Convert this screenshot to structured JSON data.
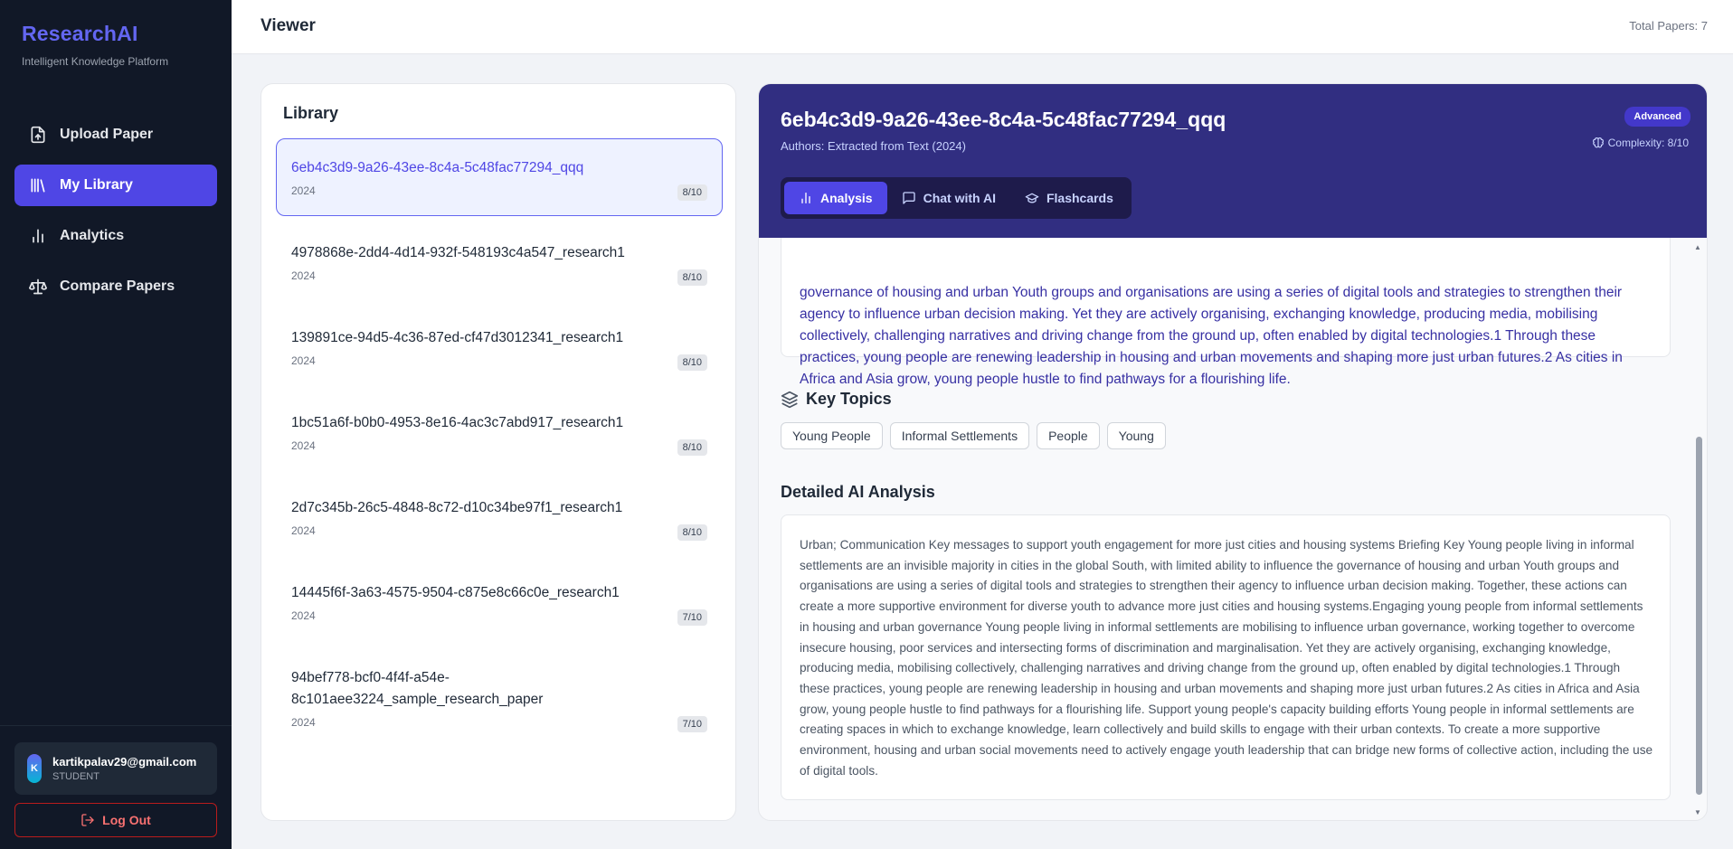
{
  "brand": {
    "title": "ResearchAI",
    "subtitle": "Intelligent Knowledge Platform"
  },
  "sidebar": {
    "items": [
      {
        "label": "Upload Paper",
        "icon": "upload-file-icon"
      },
      {
        "label": "My Library",
        "icon": "library-icon",
        "active": true
      },
      {
        "label": "Analytics",
        "icon": "bar-chart-icon"
      },
      {
        "label": "Compare Papers",
        "icon": "scale-icon"
      }
    ],
    "user": {
      "initial": "K",
      "email": "kartikpalav29@gmail.com",
      "role": "STUDENT"
    },
    "logout_label": "Log Out"
  },
  "header": {
    "title": "Viewer",
    "total_papers": "Total Papers: 7"
  },
  "library": {
    "title": "Library",
    "papers": [
      {
        "name": "6eb4c3d9-9a26-43ee-8c4a-5c48fac77294_qqq",
        "year": "2024",
        "score": "8/10"
      },
      {
        "name": "4978868e-2dd4-4d14-932f-548193c4a547_research1",
        "year": "2024",
        "score": "8/10"
      },
      {
        "name": "139891ce-94d5-4c36-87ed-cf47d3012341_research1",
        "year": "2024",
        "score": "8/10"
      },
      {
        "name": "1bc51a6f-b0b0-4953-8e16-4ac3c7abd917_research1",
        "year": "2024",
        "score": "8/10"
      },
      {
        "name": "2d7c345b-26c5-4848-8c72-d10c34be97f1_research1",
        "year": "2024",
        "score": "8/10"
      },
      {
        "name": "14445f6f-3a63-4575-9504-c875e8c66c0e_research1",
        "year": "2024",
        "score": "7/10"
      },
      {
        "name": "94bef778-bcf0-4f4f-a54e-8c101aee3224_sample_research_paper",
        "year": "2024",
        "score": "7/10"
      }
    ]
  },
  "detail": {
    "title": "6eb4c3d9-9a26-43ee-8c4a-5c48fac77294_qqq",
    "authors": "Authors: Extracted from Text (2024)",
    "level": "Advanced",
    "complexity": "Complexity: 8/10",
    "tabs": [
      {
        "label": "Analysis",
        "icon": "bar-chart-icon"
      },
      {
        "label": "Chat with AI",
        "icon": "chat-bubble-icon"
      },
      {
        "label": "Flashcards",
        "icon": "graduation-cap-icon"
      }
    ],
    "summary": "governance of housing and urban Youth groups and organisations are using a series of digital tools and strategies to strengthen their agency to influence urban decision making. Yet they are actively organising, exchanging knowledge, producing media, mobilising collectively, challenging narratives and driving change from the ground up, often enabled by digital technologies.1 Through these practices, young people are renewing leadership in housing and urban movements and shaping more just urban futures.2 As cities in Africa and Asia grow, young people hustle to find pathways for a flourishing life.",
    "key_topics_title": "Key Topics",
    "topics": [
      "Young People",
      "Informal Settlements",
      "People",
      "Young"
    ],
    "analysis_title": "Detailed AI Analysis",
    "analysis_text": "Urban; Communication Key messages to support youth engagement for more just cities and housing systems Briefing Key Young people living in informal settlements are an invisible majority in cities in the global South, with limited ability to influence the governance of housing and urban Youth groups and organisations are using a series of digital tools and strategies to strengthen their agency to influence urban decision making. Together, these actions can create a more supportive environment for diverse youth to advance more just cities and housing systems.Engaging young people from informal settlements in housing and urban governance Young people living in informal settlements are mobilising to influence urban governance, working together to overcome insecure housing, poor services and intersecting forms of discrimination and marginalisation. Yet they are actively organising, exchanging knowledge, producing media, mobilising collectively, challenging narratives and driving change from the ground up, often enabled by digital technologies.1 Through these practices, young people are renewing leadership in housing and urban movements and shaping more just urban futures.2 As cities in Africa and Asia grow, young people hustle to find pathways for a flourishing life. Support young people's capacity building efforts Young people in informal settlements are creating spaces in which to exchange knowledge, learn collectively and build skills to engage with their urban contexts. To create a more supportive environment, housing and urban social movements need to actively engage youth leadership that can bridge new forms of collective action, including the use of digital tools."
  }
}
